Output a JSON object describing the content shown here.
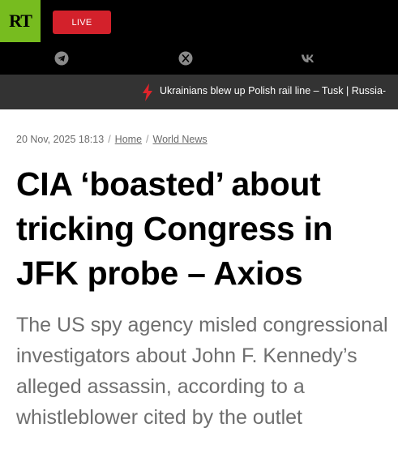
{
  "header": {
    "logo_text": "RT",
    "live_label": "LIVE",
    "social_icons": [
      "telegram-icon",
      "x-icon",
      "vk-icon"
    ]
  },
  "ticker": {
    "icon": "lightning-icon",
    "text": "Ukrainians blew up Polish rail line – Tusk | Russia-"
  },
  "article": {
    "timestamp": "20 Nov, 2025 18:13",
    "breadcrumb": [
      "Home",
      "World News"
    ],
    "title": "CIA ‘boasted’ about tricking Congress in JFK probe – Axios",
    "summary": "The US spy agency misled congressional investigators about John F. Kennedy’s alleged assassin, according to a whistleblower cited by the outlet"
  },
  "colors": {
    "brand_green": "#77bc1f",
    "live_red": "#d3212b",
    "ticker_bg": "#333333",
    "bolt_red": "#e0242b"
  }
}
